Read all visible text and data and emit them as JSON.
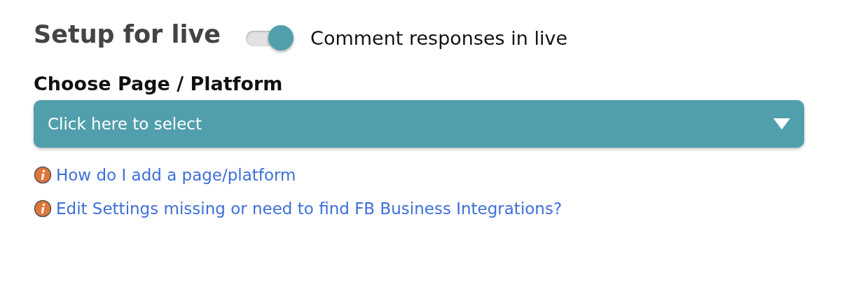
{
  "header": {
    "title": "Setup for live",
    "toggle": {
      "label": "Comment responses in live",
      "on": true
    }
  },
  "section": {
    "label": "Choose Page / Platform",
    "dropdown": {
      "placeholder": "Click here to select"
    }
  },
  "help_links": [
    {
      "text": "How do I add a page/platform"
    },
    {
      "text": "Edit Settings missing or need to find FB Business Integrations?"
    }
  ]
}
